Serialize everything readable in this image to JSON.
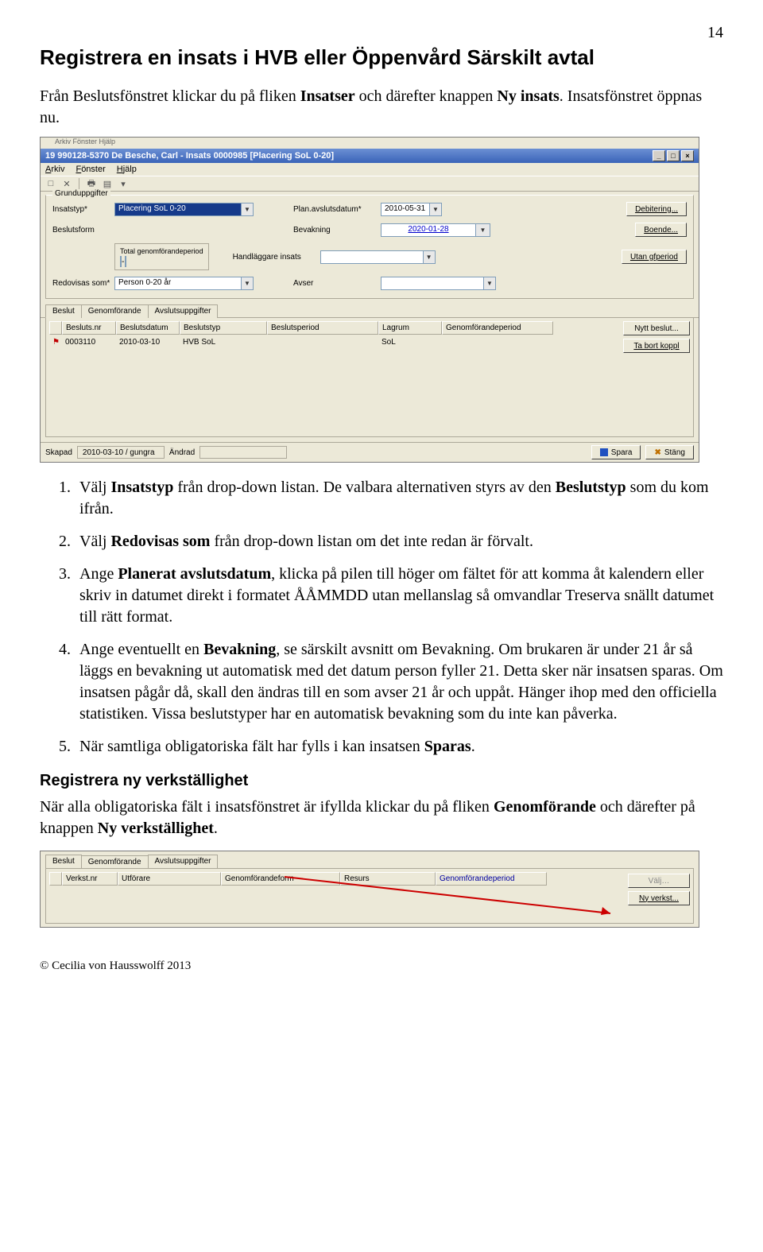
{
  "page_number": "14",
  "heading": "Registrera en insats i HVB eller Öppenvård Särskilt avtal",
  "intro": "Från Beslutsfönstret klickar du på fliken Insatser och därefter knappen Ny insats. Insatsfönstret öppnas nu.",
  "win1": {
    "faint_menu": "Arkiv   Fönster   Hjälp",
    "title": "19 990128-5370  De Besche, Carl  -  Insats  0000985  [Placering SoL 0-20]",
    "menu": {
      "arkiv": "Arkiv",
      "fonster": "Fönster",
      "hjalp": "Hjälp"
    },
    "group_legend": "Grunduppgifter",
    "lab_insatstyp": "Insatstyp*",
    "val_insatstyp": "Placering SoL 0-20",
    "lab_beslutsform": "Beslutsform",
    "lab_redovisas": "Redovisas som*",
    "val_redovisas": "Person 0-20 år",
    "lab_plan": "Plan.avslutsdatum*",
    "val_plan": "2010-05-31",
    "lab_bevakning": "Bevakning",
    "val_bevakning": "2020-01-28",
    "lab_handl": "Handläggare insats",
    "lab_avser": "Avser",
    "sub_legend": "Total genomförandeperiod",
    "sub_dash": "-",
    "btn_debitering": "Debitering...",
    "btn_boende": "Boende...",
    "btn_utan": "Utan gfperiod",
    "tabs": {
      "beslut": "Beslut",
      "genom": "Genomförande",
      "avslut": "Avslutsuppgifter"
    },
    "grid_h": [
      "Besluts.nr",
      "Beslutsdatum",
      "Beslutstyp",
      "Beslutsperiod",
      "Lagrum",
      "Genomförandeperiod"
    ],
    "grid_r": [
      "0003110",
      "2010-03-10",
      "HVB SoL",
      "",
      "SoL",
      ""
    ],
    "btn_nytt": "Nytt beslut...",
    "btn_tabort": "Ta bort koppl",
    "status": {
      "skapad_l": "Skapad",
      "skapad_v": "2010-03-10 / gungra",
      "andrad_l": "Ändrad",
      "spara": "Spara",
      "stang": "Stäng"
    }
  },
  "steps": [
    "Välj Insatstyp från drop-down listan. De valbara alternativen styrs av den Beslutstyp som du kom ifrån.",
    "Välj Redovisas som från drop-down listan om det inte redan är förvalt.",
    "Ange Planerat avslutsdatum, klicka på pilen till höger om fältet för att komma åt kalendern eller skriv in datumet direkt i formatet ÅÅMMDD utan mellanslag så omvandlar Treserva snällt datumet till rätt format.",
    "Ange eventuellt en Bevakning, se särskilt avsnitt om Bevakning. Om brukaren är under 21 år så läggs en bevakning ut automatisk med det datum person fyller 21. Detta sker när insatsen sparas. Om insatsen pågår då, skall den ändras till en som avser 21 år och uppåt. Hänger ihop med den officiella statistiken. Vissa beslutstyper har en automatisk bevakning som du inte kan påverka.",
    "När samtliga obligatoriska fält har fylls i kan insatsen Sparas."
  ],
  "sub_heading": "Registrera ny verkställighet",
  "after": "När alla obligatoriska fält i insatsfönstret är ifyllda klickar du på fliken Genomförande och därefter på knappen Ny verkställighet.",
  "win2": {
    "tabs": {
      "beslut": "Beslut",
      "genom": "Genomförande",
      "avslut": "Avslutsuppgifter"
    },
    "grid_h": [
      "Verkst.nr",
      "Utförare",
      "Genomförandeform",
      "Resurs",
      "Genomförandeperiod"
    ],
    "btn_valj": "Välj…",
    "btn_ny": "Ny verkst..."
  },
  "footer": "© Cecilia von Hausswolff 2013"
}
